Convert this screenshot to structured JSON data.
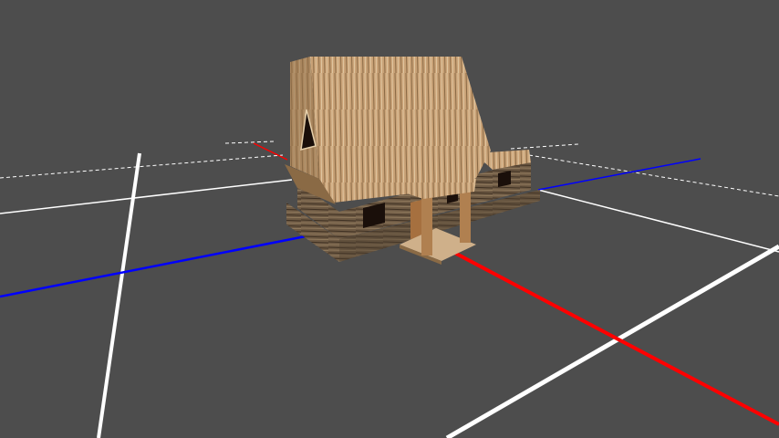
{
  "viewport": {
    "background": "#4d4d4d",
    "grid_color": "#ffffff",
    "x_axis_color": "#ff0000",
    "y_axis_color": "#0000ff"
  },
  "model": {
    "roof_color": "#c9a277",
    "roof_dark": "#8a6a45",
    "wall_color": "#6e5a44",
    "wall_dark": "#3e3022",
    "window_color": "#1a0f0a",
    "door_color": "#a6703f",
    "porch_floor": "#cfb08a"
  }
}
